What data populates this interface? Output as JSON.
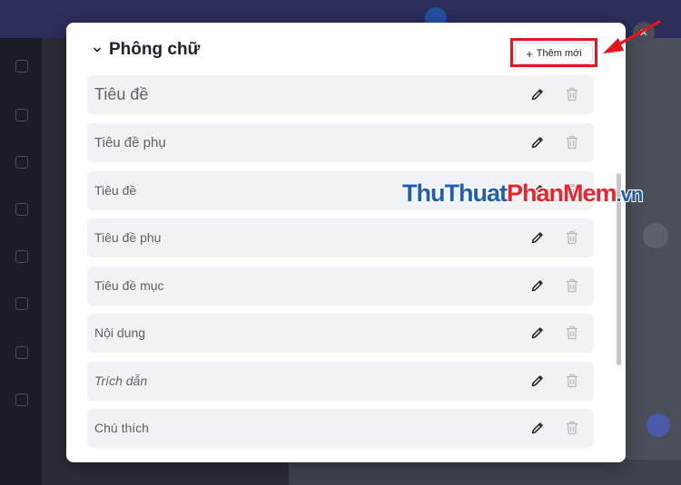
{
  "modal": {
    "title": "Phông chữ",
    "add_button_label": "Thêm mới",
    "add_button_icon": "plus-icon",
    "rows": [
      {
        "label": "Tiêu đề",
        "style": "heading"
      },
      {
        "label": "Tiêu đề phụ",
        "style": "subheading"
      },
      {
        "label": "Tiêu đề",
        "style": "small-heading"
      },
      {
        "label": "Tiêu đề phụ",
        "style": "small-subheading"
      },
      {
        "label": "Tiêu đề mục",
        "style": "section-heading"
      },
      {
        "label": "Nội dung",
        "style": "body"
      },
      {
        "label": "Trích dẫn",
        "style": "quote"
      },
      {
        "label": "Chú thích",
        "style": "caption"
      }
    ]
  },
  "watermark": {
    "part1": "ThuThuat",
    "part2": "PhanMem",
    "part3": ".vn"
  },
  "colors": {
    "highlight": "#e8141c",
    "row_background": "#f1f2f4",
    "watermark_blue": "#1e5fb0",
    "watermark_red": "#e8242e"
  }
}
